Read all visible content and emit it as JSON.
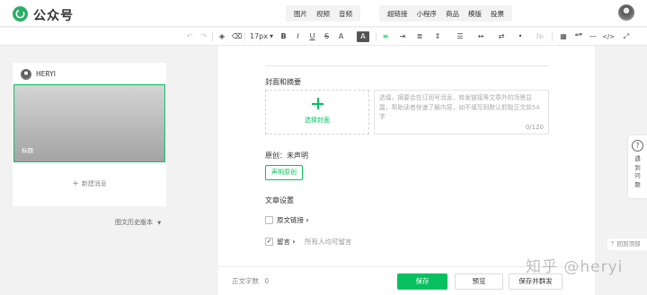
{
  "header": {
    "brand": "公众号",
    "insert_group_1": [
      "图片",
      "视频",
      "音频"
    ],
    "insert_group_2": [
      "超链接",
      "小程序",
      "商品",
      "模版",
      "投票"
    ]
  },
  "toolbar": {
    "undo_icon": "undo-icon",
    "redo_icon": "redo-icon",
    "font_size": "17px",
    "bold": "B",
    "italic": "I",
    "underline": "U",
    "strike": "S",
    "font_color": "A",
    "bg_color": "A",
    "quote": "❝❞",
    "code": "</>"
  },
  "sidebar": {
    "account_name": "HERYI",
    "cover_title": "标题",
    "new_message": "新建消息",
    "history": "图文历史版本"
  },
  "editor": {
    "cover_section": "封面和摘要",
    "choose_cover": "选择封面",
    "abstract_placeholder": "选填，摘要会在订阅号消息、转发链接等文章外的场景显露，帮助读者快速了解内容，如不填写则默认抓取正文前54字",
    "abstract_count": "0/120",
    "original_status": "原创：未声明",
    "declare_original": "声明原创",
    "article_settings": "文章设置",
    "original_link": "原文链接",
    "comment": "留言",
    "comment_option": "所有人均可留言"
  },
  "footer": {
    "word_count_label": "正文字数",
    "word_count": "0",
    "save": "保存",
    "preview": "预览",
    "save_send": "保存并群发"
  },
  "floating": {
    "help_text": "遇到问题",
    "back_top": "回到顶部"
  },
  "watermark": "知乎 @heryi",
  "colors": {
    "accent": "#07c160",
    "logo": "#2aae67"
  }
}
